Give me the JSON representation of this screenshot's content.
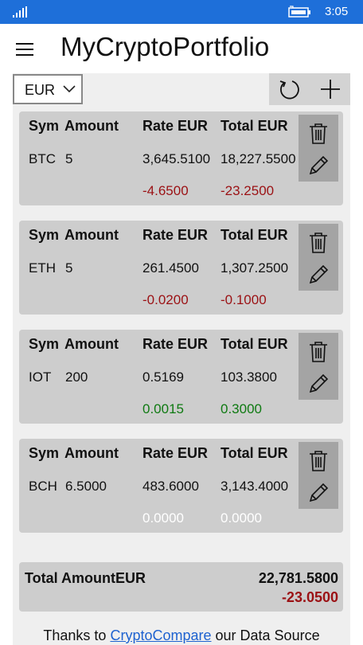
{
  "status_bar": {
    "time": "3:05",
    "icons": [
      "signal-icon",
      "battery-charging-icon"
    ]
  },
  "app": {
    "title": "MyCryptoPortfolio",
    "menu_icon": "hamburger-icon"
  },
  "toolbar": {
    "currency": "EUR",
    "dropdown_icon": "chevron-down-icon",
    "refresh_icon": "refresh-icon",
    "add_icon": "plus-icon"
  },
  "columns": {
    "sym": "Sym",
    "amount": "Amount",
    "rate": "Rate EUR",
    "total": "Total EUR"
  },
  "holdings": [
    {
      "sym": "BTC",
      "amount": "5",
      "rate": "3,645.5100",
      "total": "18,227.5500",
      "rate_change": "-4.6500",
      "total_change": "-23.2500",
      "trend": "negative"
    },
    {
      "sym": "ETH",
      "amount": "5",
      "rate": "261.4500",
      "total": "1,307.2500",
      "rate_change": "-0.0200",
      "total_change": "-0.1000",
      "trend": "negative"
    },
    {
      "sym": "IOT",
      "amount": "200",
      "rate": "0.5169",
      "total": "103.3800",
      "rate_change": "0.0015",
      "total_change": "0.3000",
      "trend": "positive"
    },
    {
      "sym": "BCH",
      "amount": "6.5000",
      "rate": "483.6000",
      "total": "3,143.4000",
      "rate_change": "0.0000",
      "total_change": "0.0000",
      "trend": "zero"
    }
  ],
  "summary": {
    "label": "Total AmountEUR",
    "total": "22,781.5800",
    "change": "-23.0500"
  },
  "footer": {
    "prefix": "Thanks to",
    "link": "CryptoCompare",
    "suffix": "our Data Source"
  },
  "colors": {
    "accent": "#1e6fd9",
    "negative": "#9b1114",
    "positive": "#0f7a12",
    "card": "#cdcdcd",
    "button_column": "#a4a4a4"
  }
}
